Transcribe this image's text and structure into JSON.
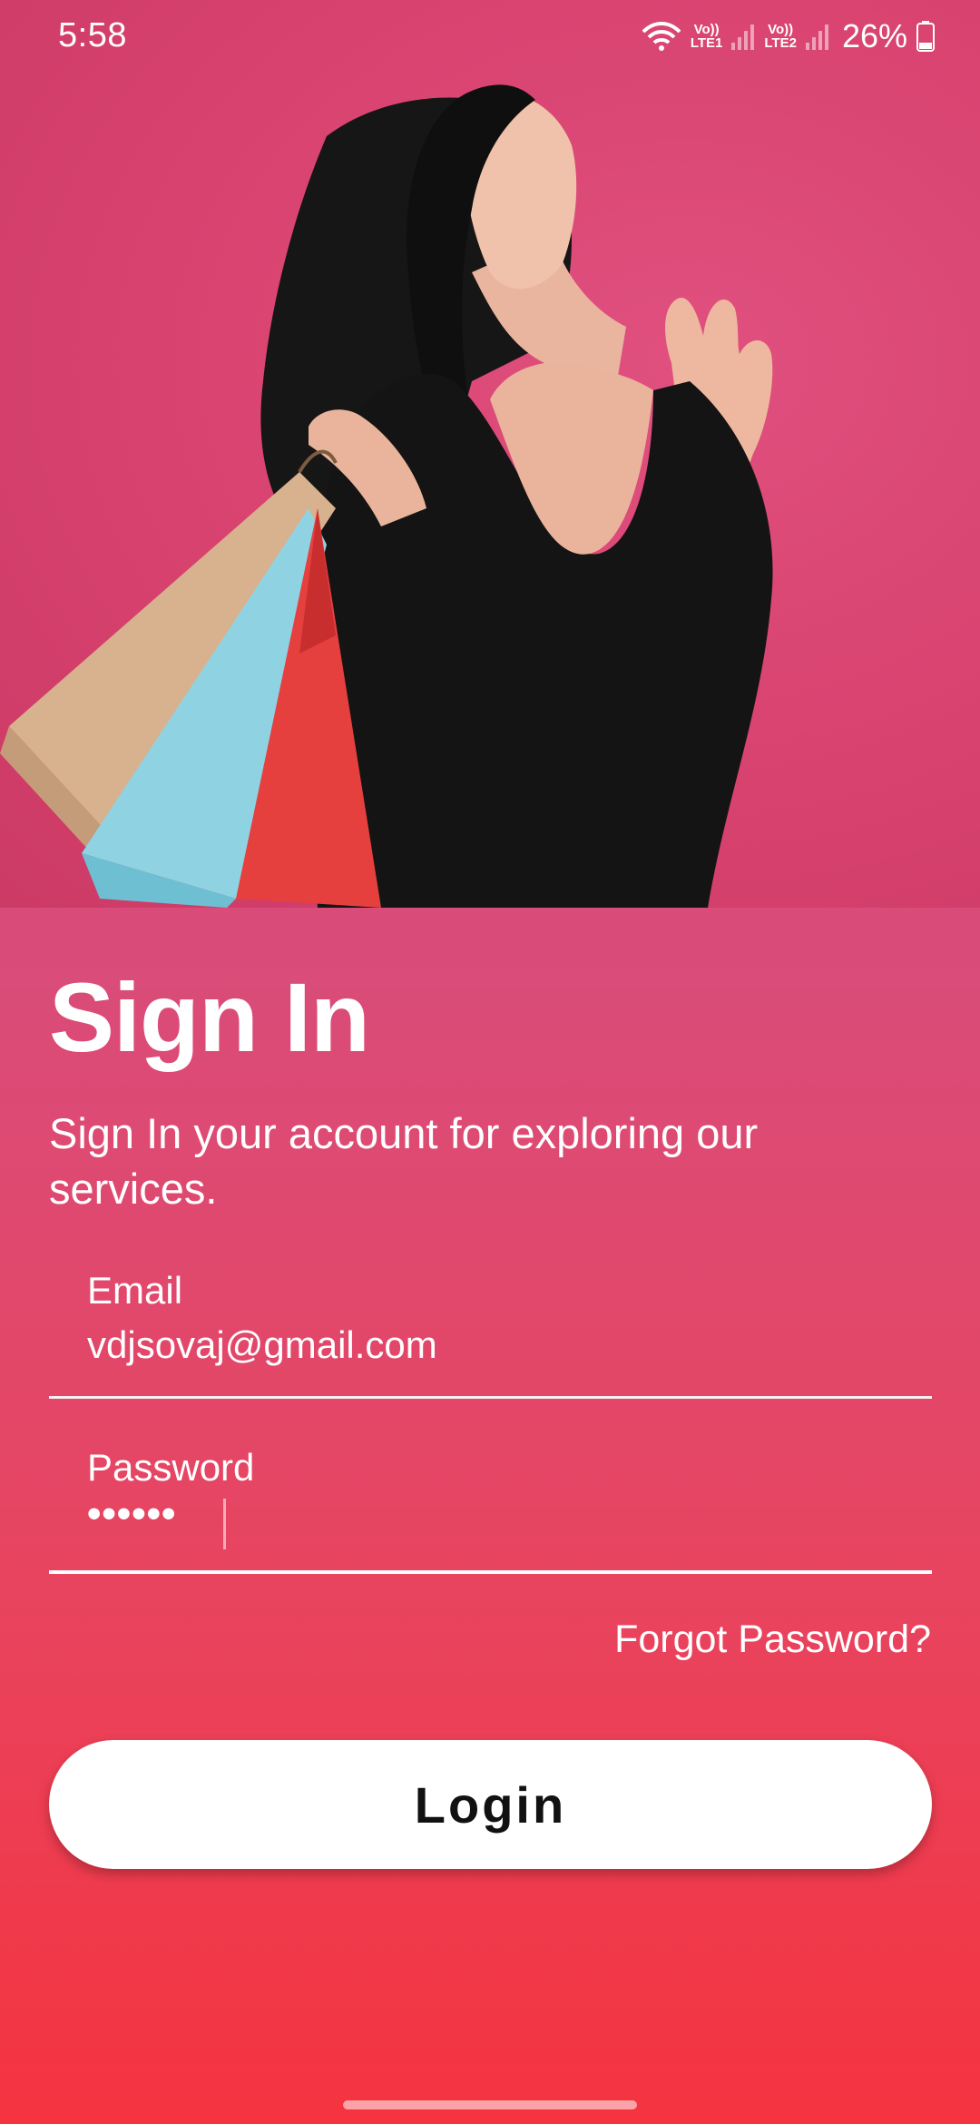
{
  "status_bar": {
    "time": "5:58",
    "sim1": [
      "Vo))",
      "LTE1"
    ],
    "sim2": [
      "Vo))",
      "LTE2"
    ],
    "battery": "26%"
  },
  "hero": {
    "icon": "woman-with-shopping-bags-photo"
  },
  "signin": {
    "title": "Sign In",
    "subtitle": "Sign In your account for exploring our services.",
    "email_label": "Email",
    "email_value": "vdjsovaj@gmail.com",
    "password_label": "Password",
    "password_value": "••••••",
    "forgot": "Forgot Password?",
    "login": "Login"
  },
  "colors": {
    "background_top": "#d94c7a",
    "background_bottom": "#f5333f",
    "button_bg": "#ffffff",
    "button_text": "#111111"
  }
}
